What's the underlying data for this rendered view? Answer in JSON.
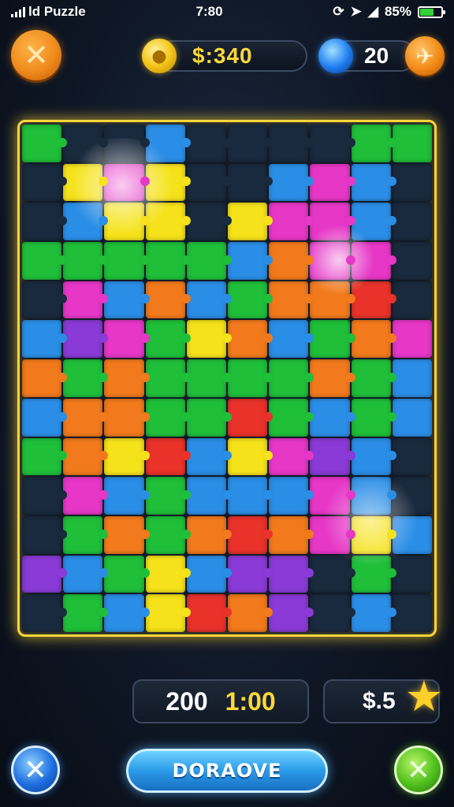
{
  "status_bar": {
    "app_label": "ld Puzzle",
    "time": "7:80",
    "battery_text": "85%",
    "icons": [
      "signal-icon",
      "sync-icon",
      "location-icon",
      "signal-strength-icon",
      "battery-icon"
    ]
  },
  "header": {
    "close_icon": "✕",
    "coins": "$:340",
    "gems": "20"
  },
  "board": {
    "columns": 10,
    "rows": 13,
    "palette": {
      "G": "#1fbf3a",
      "B": "#2b8ee6",
      "Y": "#f5e21a",
      "O": "#f27a1c",
      "P": "#e637c7",
      "V": "#8a3ad6",
      "R": "#e8322a",
      "D": "#1a2a3e",
      "T": "#19a5b8"
    },
    "layout": [
      "GDDBDDDDGG",
      "DYPYDDBPBD",
      "DBYYDYPPBD",
      "GGGGGBOPPD",
      "DPBOBGOORD",
      "BVPGYOBGOP",
      "OGOGGGGOGB",
      "BOOGGRGBGB",
      "GOYRBYPVBD",
      "DPBGBBBPBD",
      "DGOGOROPYB",
      "VBGYBVVDGD",
      "DGBYROVDBD"
    ]
  },
  "footer": {
    "score": "200",
    "timer": "1:00",
    "money": "$.5",
    "main_button": "DORAOVE",
    "cancel_icon": "✕",
    "confirm_icon": "✕"
  },
  "colors": {
    "board_border": "#ffd43b",
    "coin_text": "#ffd838",
    "timer_text": "#ffd838"
  }
}
